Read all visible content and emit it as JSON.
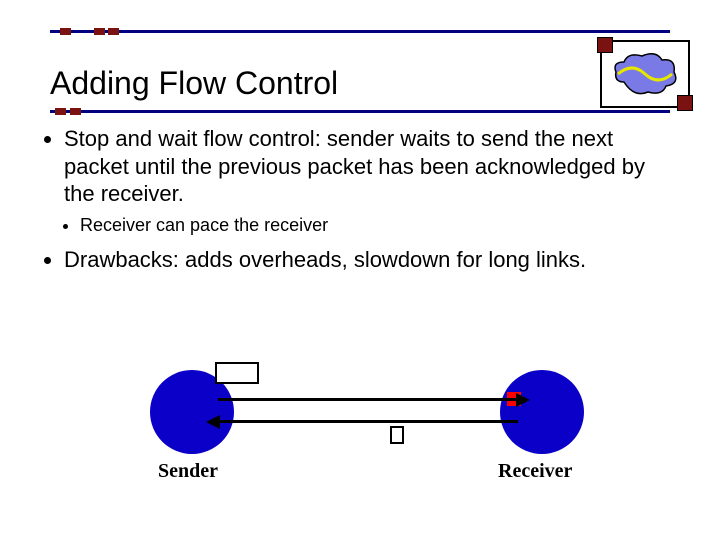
{
  "title": "Adding Flow Control",
  "bullets": {
    "main1": "Stop and wait flow control: sender waits to send the next packet until the previous packet has been acknowledged by the receiver.",
    "sub1": "Receiver can pace the receiver",
    "main2": "Drawbacks: adds overheads, slowdown for long links."
  },
  "diagram": {
    "sender_label": "Sender",
    "receiver_label": "Receiver"
  }
}
